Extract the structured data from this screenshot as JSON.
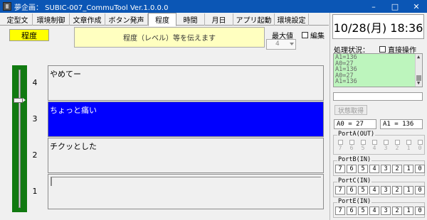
{
  "window": {
    "title": "夢企画： SUBIC-007_CommuTool Ver.1.0.0.0",
    "controls": [
      "–",
      "□",
      "✕"
    ]
  },
  "tabs": [
    {
      "label": "定型文",
      "active": false
    },
    {
      "label": "環境制御",
      "active": false
    },
    {
      "label": "文章作成",
      "active": false
    },
    {
      "label": "ボタン発声",
      "active": false
    },
    {
      "label": "程度",
      "active": true
    },
    {
      "label": "時間",
      "active": false
    },
    {
      "label": "月日",
      "active": false
    },
    {
      "label": "アプリ起動",
      "active": false
    },
    {
      "label": "環境設定",
      "active": false
    }
  ],
  "level_panel": {
    "title": "程度",
    "description": "程度（レベル）等を伝えます",
    "max_label": "最大値",
    "max_value": "4",
    "edit_label": "編集",
    "slider_value": 3,
    "items": [
      {
        "num": "4",
        "text": "やめてー",
        "selected": false
      },
      {
        "num": "3",
        "text": "ちょっと痛い",
        "selected": true
      },
      {
        "num": "2",
        "text": "チクッとした",
        "selected": false
      },
      {
        "num": "1",
        "text": "",
        "selected": false
      }
    ]
  },
  "right_panel": {
    "clock": "10/28(月) 18:36",
    "status_label": "処理状況：",
    "direct_label": "直接操作",
    "log_lines": [
      "A1=136",
      "A0=27",
      "A1=136",
      "A0=27",
      "A1=136"
    ],
    "state_button": "状態取得",
    "a0": "A0 = 27",
    "a1": "A1 = 136",
    "portA": {
      "title": "PortA(OUT)",
      "bits": [
        "7",
        "6",
        "5",
        "4",
        "3",
        "2",
        "1",
        "0"
      ]
    },
    "portB": {
      "title": "PortB(IN)",
      "bits": [
        "7",
        "6",
        "5",
        "4",
        "3",
        "2",
        "1",
        "0"
      ]
    },
    "portC": {
      "title": "PortC(IN)",
      "bits": [
        "7",
        "6",
        "5",
        "4",
        "3",
        "2",
        "1",
        "0"
      ]
    },
    "portE": {
      "title": "PortE(IN)",
      "bits": [
        "7",
        "6",
        "5",
        "4",
        "3",
        "2",
        "1",
        "0"
      ]
    }
  }
}
